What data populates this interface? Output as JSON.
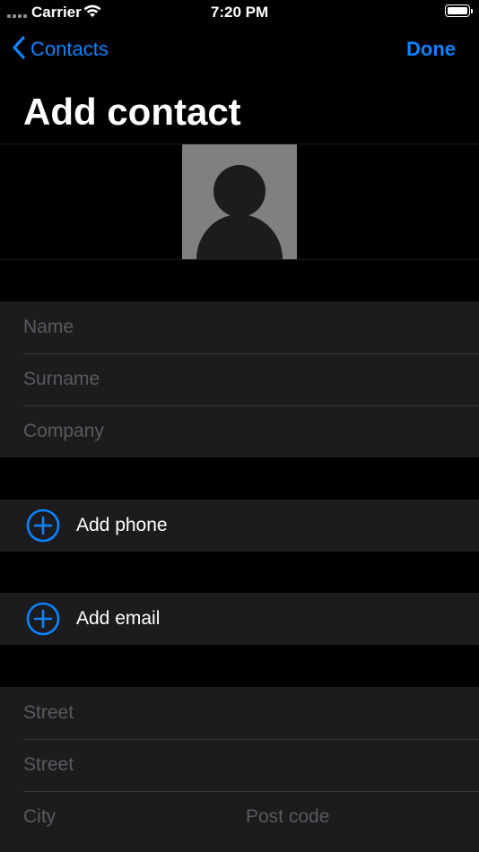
{
  "status": {
    "carrier": "Carrier",
    "time": "7:20 PM"
  },
  "nav": {
    "back_label": "Contacts",
    "done_label": "Done"
  },
  "title": "Add contact",
  "name_group": {
    "name_placeholder": "Name",
    "surname_placeholder": "Surname",
    "company_placeholder": "Company"
  },
  "phone": {
    "label": "Add phone"
  },
  "email": {
    "label": "Add email"
  },
  "address": {
    "street1_placeholder": "Street",
    "street2_placeholder": "Street",
    "city_placeholder": "City",
    "postcode_placeholder": "Post code"
  },
  "colors": {
    "accent": "#0a84ff",
    "background": "#000000",
    "cell": "#1c1c1e",
    "placeholder": "#5a5a5e"
  },
  "icons": [
    "wifi-icon",
    "battery-icon",
    "chevron-left-icon",
    "person-placeholder-icon",
    "plus-circle-icon"
  ]
}
